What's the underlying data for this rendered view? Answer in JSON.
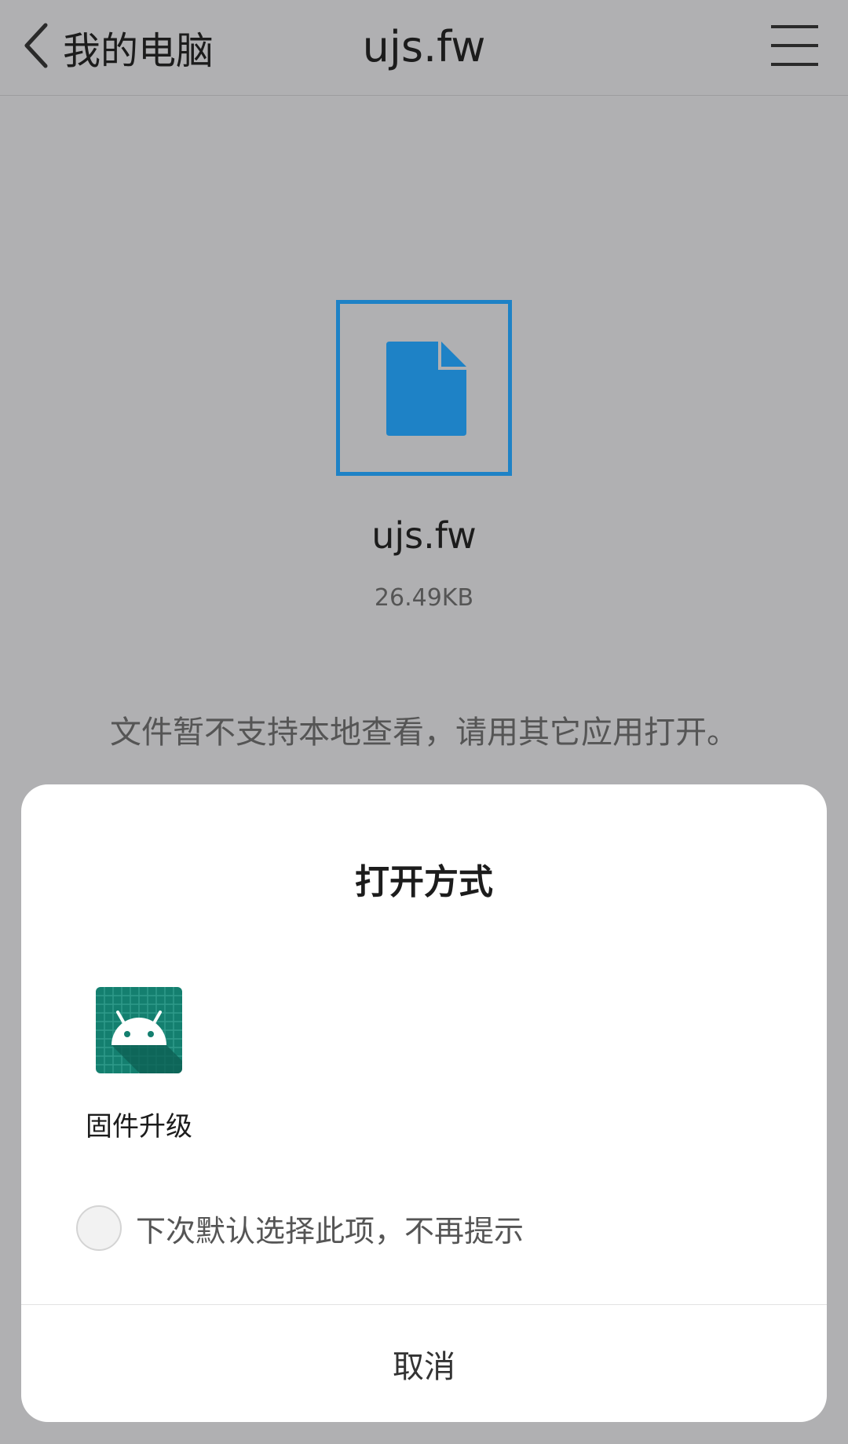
{
  "header": {
    "back_label": "我的电脑",
    "title": "ujs.fw",
    "back_icon": "chevron-left-icon",
    "menu_icon": "hamburger-menu-icon"
  },
  "file": {
    "name": "ujs.fw",
    "size": "26.49KB",
    "icon": "file-document-icon",
    "notice": "文件暂不支持本地查看，请用其它应用打开。"
  },
  "dialog": {
    "title": "打开方式",
    "apps": [
      {
        "label": "固件升级",
        "icon": "android-app-icon"
      }
    ],
    "default_option": {
      "label": "下次默认选择此项，不再提示",
      "checked": false
    },
    "cancel_label": "取消"
  },
  "colors": {
    "background_dim": "#b0b0b2",
    "file_icon_blue": "#1e82c6",
    "app_icon_teal": "#147f6f",
    "dialog_bg": "#ffffff"
  }
}
